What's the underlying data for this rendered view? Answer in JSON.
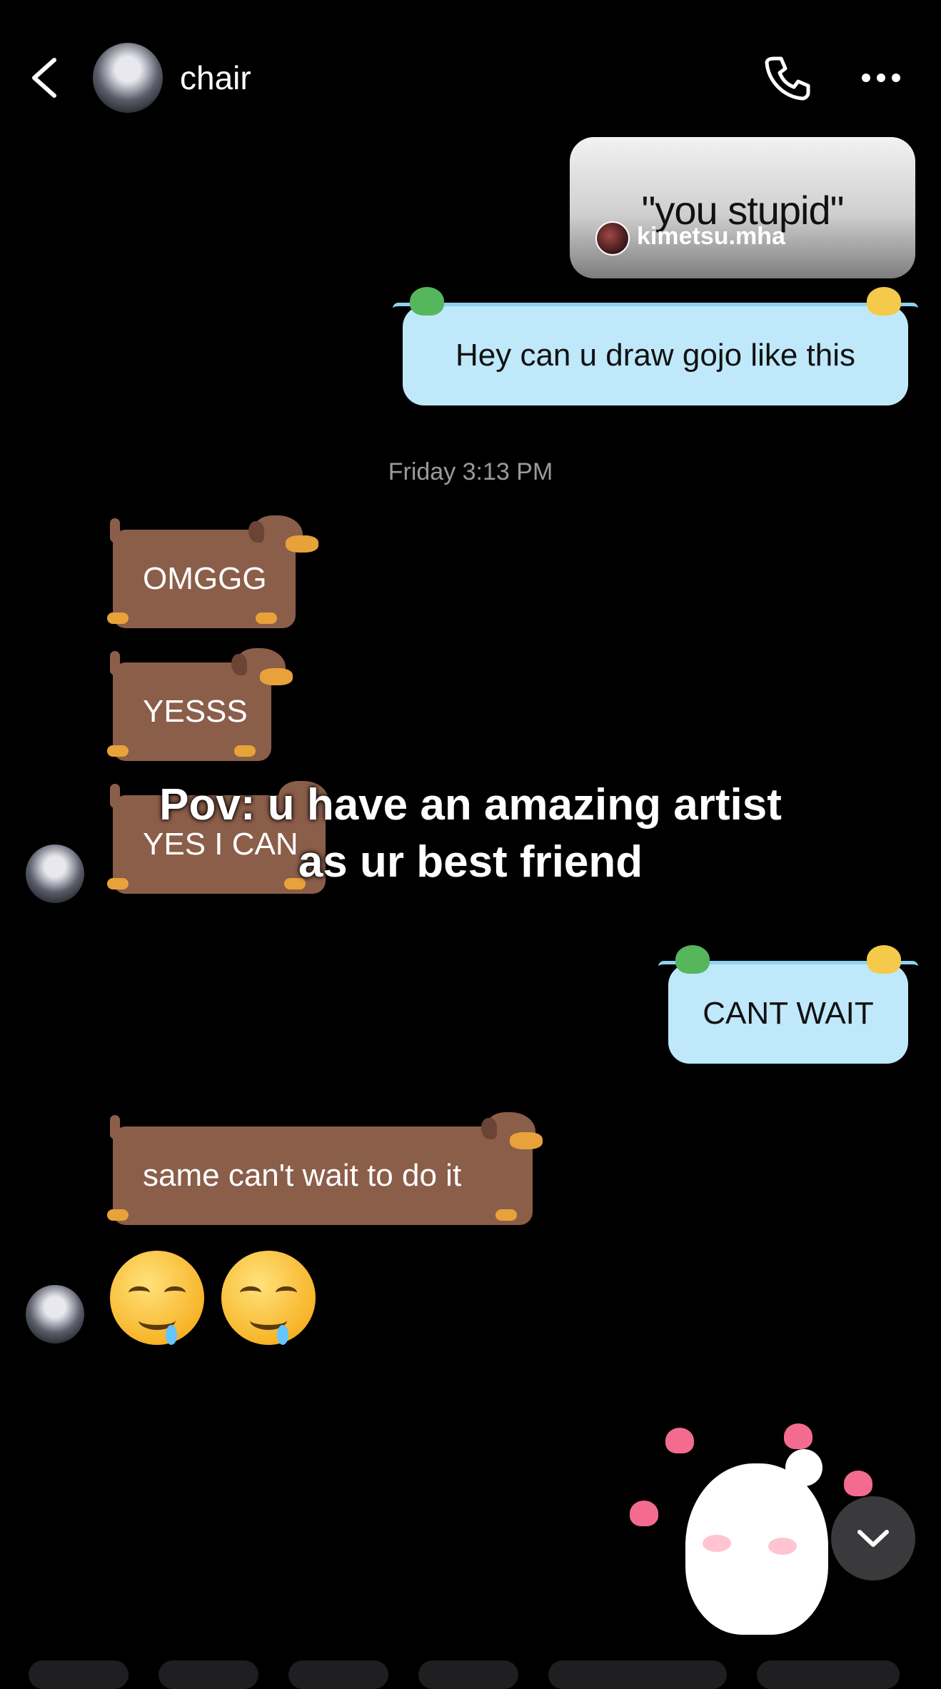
{
  "header": {
    "contact_name": "chair",
    "icons": [
      "back-icon",
      "phone-icon",
      "more-icon"
    ]
  },
  "reel": {
    "text": "\"you stupid\"",
    "username": "kimetsu.mha"
  },
  "messages": {
    "sent1": "Hey can u draw gojo like this",
    "timestamp": "Friday 3:13 PM",
    "recv1": "OMGGG",
    "recv2": "YESSS",
    "recv3": "YES I CAN",
    "sent2": "CANT WAIT",
    "recv4": "same can't wait to do it"
  },
  "caption": {
    "line1": "Pov: u have an amazing artist",
    "line2": "as ur best friend"
  },
  "colors": {
    "background": "#000000",
    "sent_bubble": "#bfe8fb",
    "received_bubble": "#8b5e4a",
    "timestamp": "#9a9a9a"
  }
}
